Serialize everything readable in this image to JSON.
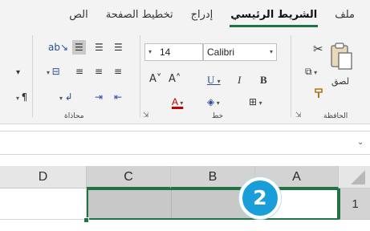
{
  "ribbon_tabs": [
    "ملف",
    "الشريط الرئيسي",
    "إدراج",
    "تخطيط الصفحة",
    "الص"
  ],
  "active_tab": "الشريط الرئيسي",
  "accent_color": "#217346",
  "clipboard": {
    "paste_label": "لصق",
    "group_label": "الحافظة"
  },
  "font": {
    "name": "Calibri",
    "size": "14",
    "group_label": "خط"
  },
  "alignment": {
    "group_label": "محاذاة"
  },
  "sheet": {
    "columns": [
      "A",
      "B",
      "C",
      "D"
    ],
    "selected_columns": [
      "A",
      "B",
      "C"
    ],
    "rows": [
      "1"
    ]
  },
  "step_badge": "2",
  "icons": {
    "paste": "paste-icon",
    "cut": "cut-icon",
    "copy": "copy-icon",
    "format_painter": "format-painter-icon",
    "bold": "bold-icon",
    "italic": "italic-icon",
    "underline": "underline-icon",
    "borders": "borders-icon",
    "fill": "fill-color-icon",
    "font_color": "font-color-icon",
    "grow_font": "grow-font-icon",
    "shrink_font": "shrink-font-icon",
    "wrap_text": "wrap-text-icon",
    "merge": "merge-center-icon",
    "orientation": "orientation-icon"
  }
}
